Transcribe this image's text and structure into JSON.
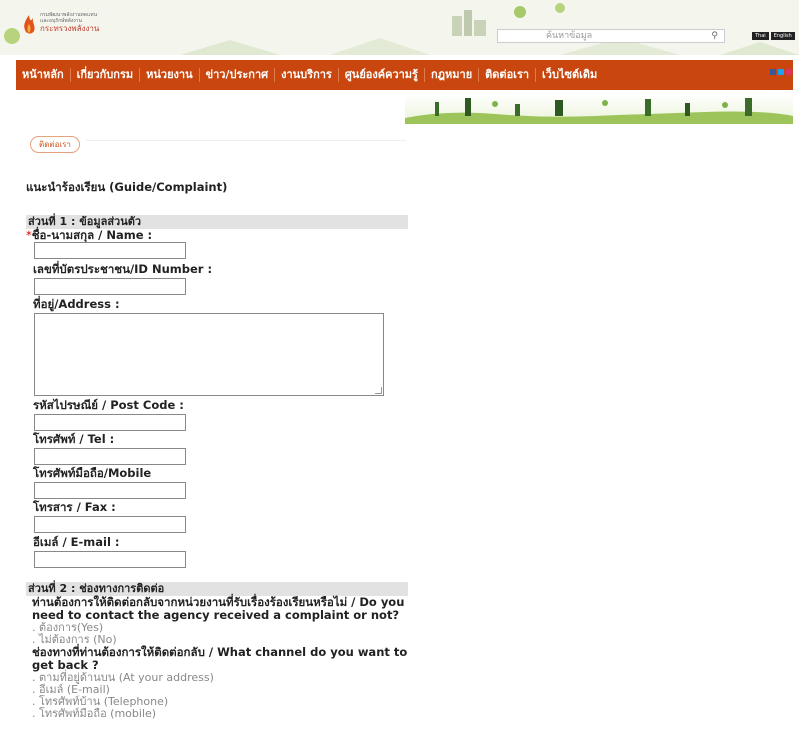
{
  "header": {
    "logo_line1": "กรมพัฒนาพลังงานทดแทน",
    "logo_line2": "และอนุรักษ์พลังงาน",
    "logo_line3": "กระทรวงพลังงาน",
    "search_placeholder": "ค้นหาข้อมูล",
    "langs": [
      "Thai",
      "English"
    ]
  },
  "nav": {
    "items": [
      "หน้าหลัก",
      "เกี่ยวกับกรม",
      "หน่วยงาน",
      "ข่าว/ประกาศ",
      "งานบริการ",
      "ศูนย์องค์ความรู้",
      "กฎหมาย",
      "ติดต่อเรา",
      "เว็บไซต์เดิม"
    ]
  },
  "breadcrumb": "ติดต่อเรา",
  "page_title": "แนะนำร้องเรียน (Guide/Complaint)",
  "section1": {
    "title": "ส่วนที่ 1 : ข้อมูลส่วนตัว",
    "name_label": "ชื่อ-นามสกุล / Name :",
    "id_label": "เลขที่บัตรประชาชน/ID Number :",
    "address_label": "ที่อยู่/Address :",
    "postcode_label": "รหัสไปรษณีย์ / Post Code :",
    "tel_label": "โทรศัพท์ / Tel :",
    "mobile_label": "โทรศัพท์มือถือ/Mobile",
    "fax_label": "โทรสาร / Fax :",
    "email_label": "อีเมล์ / E-mail :"
  },
  "section2": {
    "title": "ส่วนที่ 2 : ช่องทางการติดต่อ",
    "q1": "ท่านต้องการให้ติดต่อกลับจากหน่วยงานที่รับเรื่องร้องเรียนหรือไม่ / Do you need to contact the agency received a complaint or not?",
    "q1_options": [
      ". ต้องการ(Yes)",
      ". ไม่ต้องการ (No)"
    ],
    "q2": "ช่องทางที่ท่านต้องการให้ติดต่อกลับ / What channel do you want to get back ?",
    "q2_options": [
      ". ตามที่อยู่ด้านบน (At your address)",
      ". อีเมล์ (E-mail)",
      ". โทรศัพท์บ้าน (Telephone)",
      ". โทรศัพท์มือถือ (mobile)"
    ]
  }
}
